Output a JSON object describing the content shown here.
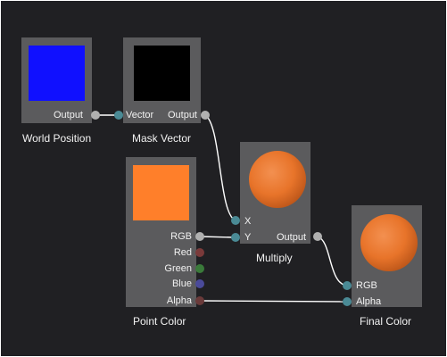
{
  "nodes": {
    "world_position": {
      "title": "World Position",
      "preview_color": "#1010ff",
      "outputs": [
        "Output"
      ]
    },
    "mask_vector": {
      "title": "Mask Vector",
      "preview_color": "#000000",
      "inputs": [
        "Vector"
      ],
      "outputs": [
        "Output"
      ]
    },
    "multiply": {
      "title": "Multiply",
      "preview_color": "#e8742a",
      "inputs": [
        "X",
        "Y"
      ],
      "outputs": [
        "Output"
      ]
    },
    "point_color": {
      "title": "Point Color",
      "preview_color": "#ff7f2a",
      "outputs": [
        "RGB",
        "Red",
        "Green",
        "Blue",
        "Alpha"
      ]
    },
    "final_color": {
      "title": "Final Color",
      "preview_color": "#e8742a",
      "inputs": [
        "RGB",
        "Alpha"
      ]
    }
  },
  "colors": {
    "canvas": "#202023",
    "node_body": "#5b5b5d",
    "wire": "#ffffff",
    "port_default": "#b0b0b0",
    "port_input": "#4a8a95",
    "port_red": "#7a3a3a",
    "port_green": "#3a7a3a",
    "port_blue": "#4a4a9a",
    "port_alpha": "#6a3a3a"
  }
}
